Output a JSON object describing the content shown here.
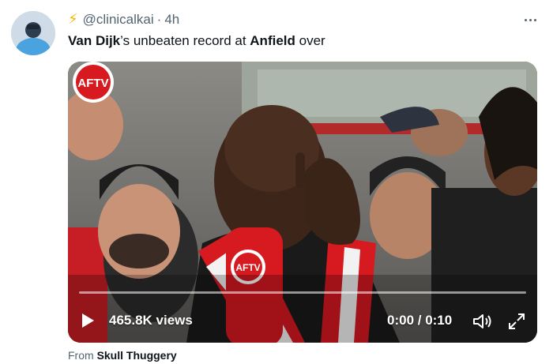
{
  "tweet": {
    "handle": "@clinicalkai",
    "separator": "·",
    "time": "4h",
    "text_parts": [
      "Van Dijk",
      "’s unbeaten record at ",
      "Anfield",
      " over"
    ]
  },
  "video": {
    "badge": "AFTV",
    "mic_label": "AFTV",
    "views": "465.8K views",
    "timer": "0:00 / 0:10",
    "progress": 0.0
  },
  "attribution": {
    "prefix": "From",
    "source": "Skull Thuggery"
  },
  "icons": [
    "bolt-emoji",
    "more-icon",
    "play-icon",
    "volume-icon",
    "fullscreen-icon"
  ],
  "colors": {
    "bolt": "#f4b400",
    "scarf_red": "#d71920",
    "text_secondary": "#536471"
  }
}
